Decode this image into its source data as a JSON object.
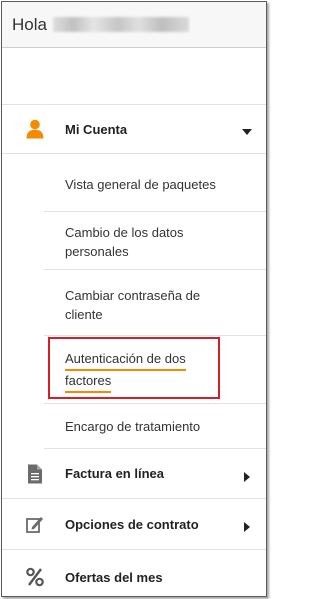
{
  "header": {
    "greeting": "Hola"
  },
  "menu": {
    "mi_cuenta": {
      "label": "Mi Cuenta",
      "expanded": true,
      "items": [
        {
          "label": "Vista general de paquetes"
        },
        {
          "label_line1": "Cambio de los datos",
          "label_line2": "personales"
        },
        {
          "label_line1": "Cambiar contraseña de",
          "label_line2": "cliente"
        },
        {
          "label_line1": "Autenticación de dos",
          "label_line2": "factores",
          "highlighted": true
        },
        {
          "label": "Encargo de tratamiento"
        }
      ]
    },
    "factura": {
      "label": "Factura en línea"
    },
    "opciones": {
      "label": "Opciones de contrato"
    },
    "ofertas": {
      "label": "Ofertas del mes"
    }
  },
  "icons": {
    "mi_cuenta": "user-icon",
    "factura": "document-icon",
    "opciones": "edit-icon",
    "ofertas": "percent-icon"
  },
  "colors": {
    "accent_orange": "#f38a00",
    "highlight_red": "#d31f26",
    "text": "#333333"
  }
}
